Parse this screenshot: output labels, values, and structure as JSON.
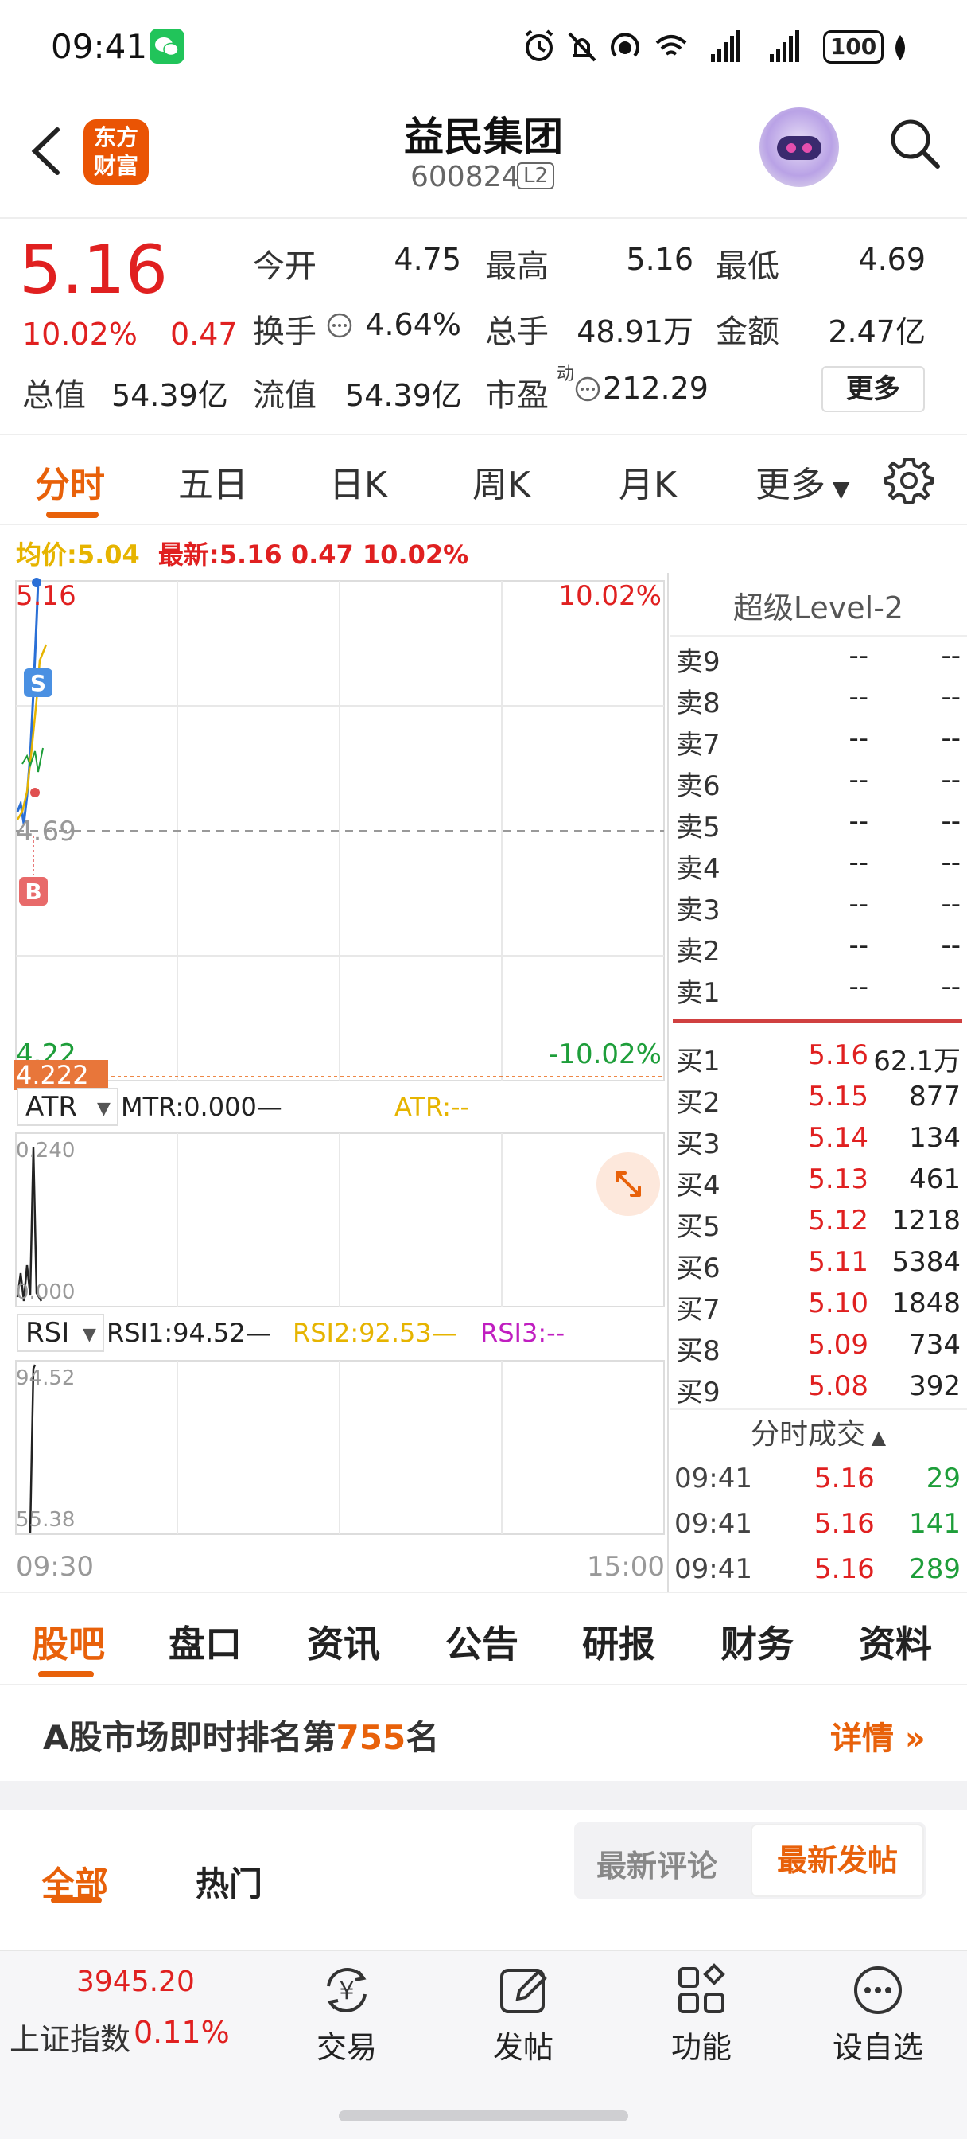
{
  "status_bar": {
    "time": "09:41",
    "battery": "100"
  },
  "header": {
    "name": "益民集团",
    "code": "600824",
    "level_badge": "L2",
    "logo_line1": "东方",
    "logo_line2": "财富"
  },
  "quote": {
    "price": "5.16",
    "change_pct": "10.02%",
    "change": "0.47",
    "open_label": "今开",
    "open": "4.75",
    "high_label": "最高",
    "high": "5.16",
    "low_label": "最低",
    "low": "4.69",
    "turnover_label": "换手",
    "turnover": "4.64%",
    "volume_label": "总手",
    "volume": "48.91万",
    "amount_label": "金额",
    "amount": "2.47亿",
    "mktcap_label": "总值",
    "mktcap": "54.39亿",
    "float_label": "流值",
    "float": "54.39亿",
    "pe_label": "市盈",
    "pe_sup": "动",
    "pe": "212.29",
    "more": "更多"
  },
  "chart_tabs": [
    "分时",
    "五日",
    "日K",
    "周K",
    "月K",
    "更多"
  ],
  "avg_line": {
    "avg_label": "均价:",
    "avg": "5.04",
    "latest_label": "最新:",
    "latest": "5.16 0.47 10.02%"
  },
  "intraday": {
    "y_top": "5.16",
    "y_mid": "4.69",
    "y_bottom": "4.22",
    "pct_top": "10.02%",
    "pct_bottom": "-10.02%",
    "price_tag": "4.222",
    "x_start": "09:30",
    "x_end": "15:00",
    "sell_marker": "S",
    "buy_marker": "B"
  },
  "atr": {
    "name": "ATR",
    "mtr": "MTR:0.000—",
    "atr": "ATR:--",
    "y_top": "0.240",
    "y_bottom": "0.000"
  },
  "rsi": {
    "name": "RSI",
    "rsi1": "RSI1:94.52—",
    "rsi2": "RSI2:92.53—",
    "rsi3": "RSI3:--",
    "y_top": "94.52",
    "y_bottom": "55.38"
  },
  "order_book": {
    "title": "超级Level-2",
    "asks": [
      {
        "label": "卖9",
        "price": "--",
        "vol": "--"
      },
      {
        "label": "卖8",
        "price": "--",
        "vol": "--"
      },
      {
        "label": "卖7",
        "price": "--",
        "vol": "--"
      },
      {
        "label": "卖6",
        "price": "--",
        "vol": "--"
      },
      {
        "label": "卖5",
        "price": "--",
        "vol": "--"
      },
      {
        "label": "卖4",
        "price": "--",
        "vol": "--"
      },
      {
        "label": "卖3",
        "price": "--",
        "vol": "--"
      },
      {
        "label": "卖2",
        "price": "--",
        "vol": "--"
      },
      {
        "label": "卖1",
        "price": "--",
        "vol": "--"
      }
    ],
    "bids": [
      {
        "label": "买1",
        "price": "5.16",
        "vol": "62.1万"
      },
      {
        "label": "买2",
        "price": "5.15",
        "vol": "877"
      },
      {
        "label": "买3",
        "price": "5.14",
        "vol": "134"
      },
      {
        "label": "买4",
        "price": "5.13",
        "vol": "461"
      },
      {
        "label": "买5",
        "price": "5.12",
        "vol": "1218"
      },
      {
        "label": "买6",
        "price": "5.11",
        "vol": "5384"
      },
      {
        "label": "买7",
        "price": "5.10",
        "vol": "1848"
      },
      {
        "label": "买8",
        "price": "5.09",
        "vol": "734"
      },
      {
        "label": "买9",
        "price": "5.08",
        "vol": "392"
      }
    ],
    "trades_title": "分时成交",
    "trades": [
      {
        "time": "09:41",
        "price": "5.16",
        "vol": "29"
      },
      {
        "time": "09:41",
        "price": "5.16",
        "vol": "141"
      },
      {
        "time": "09:41",
        "price": "5.16",
        "vol": "289"
      }
    ]
  },
  "bottom_tabs": [
    "股吧",
    "盘口",
    "资讯",
    "公告",
    "研报",
    "财务",
    "资料"
  ],
  "rank": {
    "prefix": "A股市场即时排名第",
    "num": "755",
    "suffix": "名",
    "detail": "详情"
  },
  "filter": {
    "all": "全部",
    "hot": "热门",
    "latest_comment": "最新评论",
    "latest_post": "最新发帖"
  },
  "bottom_nav": {
    "index_value": "3945.20",
    "index_name": "上证指数",
    "index_pct": "0.11%",
    "items": [
      "交易",
      "发帖",
      "功能",
      "设自选"
    ]
  },
  "colors": {
    "up": "#e02020",
    "down": "#1e9e3a",
    "accent": "#e8610a",
    "avg": "#e6b400"
  }
}
